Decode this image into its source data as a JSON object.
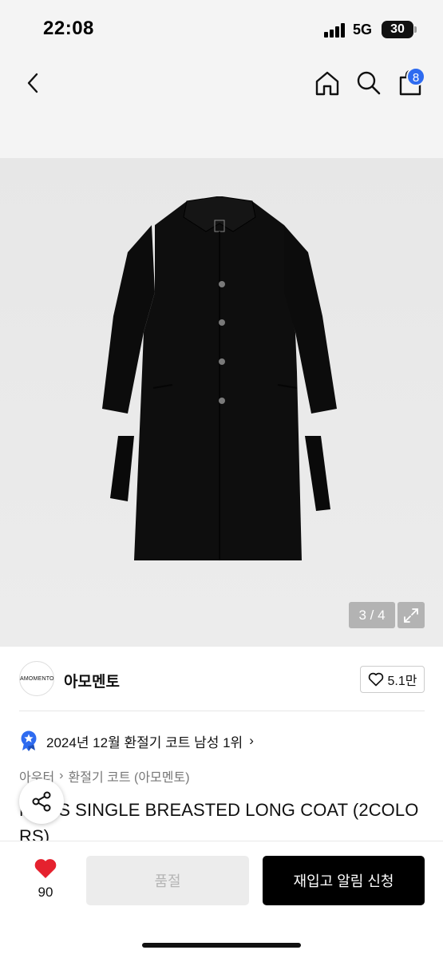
{
  "status_bar": {
    "time": "22:08",
    "network": "5G",
    "battery": "30"
  },
  "header": {
    "cart_badge": "8",
    "icons": [
      "back-icon",
      "home-icon",
      "search-icon",
      "cart-icon"
    ]
  },
  "product_image": {
    "counter": "3 / 4",
    "expand_icon": "expand-icon"
  },
  "brand": {
    "logo_text": "AMOMENTO",
    "name": "아모멘토",
    "likes": "5.1만"
  },
  "ranking": {
    "text": "2024년 12월 환절기 코트 남성 1위",
    "chevron": "›"
  },
  "breadcrumb": {
    "category": "아우터",
    "separator": "›",
    "subcategory": "환절기 코트 (아모멘토)"
  },
  "product": {
    "title": "MENS SINGLE BREASTED LONG COAT (2COLORS)"
  },
  "bottom_bar": {
    "wish_count": "90",
    "soldout_label": "품절",
    "restock_label": "재입고 알림 신청"
  },
  "colors": {
    "accent_blue": "#2e6bf0",
    "heart_red": "#e5212e",
    "black": "#000000"
  }
}
